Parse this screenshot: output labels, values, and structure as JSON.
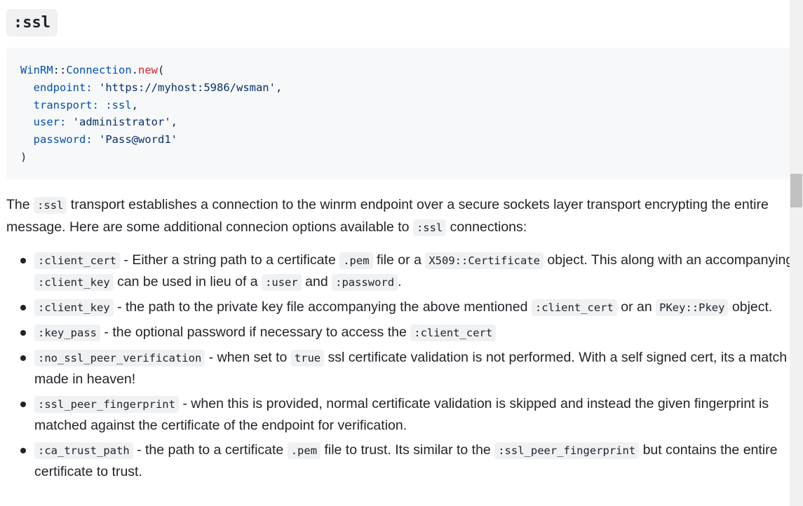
{
  "heading": ":ssl",
  "code": {
    "line1": {
      "const": "WinRM",
      "sep": "::",
      "const2": "Connection",
      "dot": ".",
      "method": "new",
      "paren": "("
    },
    "line2": {
      "key": "endpoint:",
      "value": "'https://myhost:5986/wsman'",
      "comma": ","
    },
    "line3": {
      "key": "transport:",
      "value": ":ssl",
      "comma": ","
    },
    "line4": {
      "key": "user:",
      "value": "'administrator'",
      "comma": ","
    },
    "line5": {
      "key": "password:",
      "value": "'Pass@word1'"
    },
    "line6": {
      "paren": ")"
    }
  },
  "intro": {
    "t1": "The ",
    "c1": ":ssl",
    "t2": " transport establishes a connection to the winrm endpoint over a secure sockets layer transport encrypting the entire message. Here are some additional connecion options available to ",
    "c2": ":ssl",
    "t3": " connections:"
  },
  "options": [
    {
      "c1": ":client_cert",
      "t1": " - Either a string path to a certificate ",
      "c2": ".pem",
      "t2": " file or a ",
      "c3": "X509::Certificate",
      "t3": " object. This along with an accompanying ",
      "c4": ":client_key",
      "t4": " can be used in lieu of a ",
      "c5": ":user",
      "t5": " and ",
      "c6": ":password",
      "t6": "."
    },
    {
      "c1": ":client_key",
      "t1": " - the path to the private key file accompanying the above mentioned ",
      "c2": ":client_cert",
      "t2": " or an ",
      "c3": "PKey::Pkey",
      "t3": " object."
    },
    {
      "c1": ":key_pass",
      "t1": " - the optional password if necessary to access the ",
      "c2": ":client_cert"
    },
    {
      "c1": ":no_ssl_peer_verification",
      "t1": " - when set to ",
      "c2": "true",
      "t2": " ssl certificate validation is not performed. With a self signed cert, its a match made in heaven!"
    },
    {
      "c1": ":ssl_peer_fingerprint",
      "t1": " - when this is provided, normal certificate validation is skipped and instead the given fingerprint is matched against the certificate of the endpoint for verification."
    },
    {
      "c1": ":ca_trust_path",
      "t1": " - the path to a certificate ",
      "c2": ".pem",
      "t2": " file to trust. Its similar to the ",
      "c3": ":ssl_peer_fingerprint",
      "t3": " but contains the entire certificate to trust."
    }
  ]
}
